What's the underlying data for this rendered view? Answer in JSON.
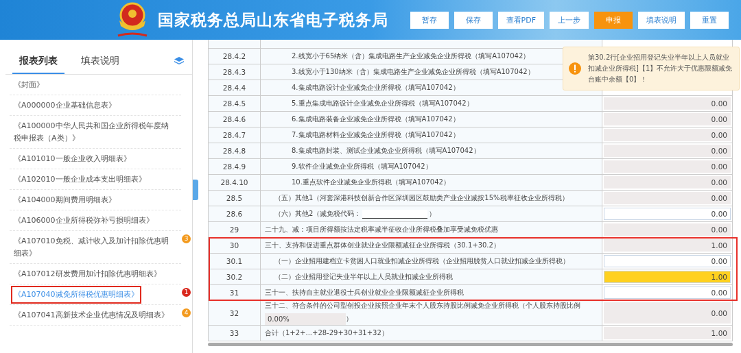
{
  "header": {
    "title": "国家税务总局山东省电子税务局",
    "buttons": [
      {
        "label": "暂存",
        "kind": "default"
      },
      {
        "label": "保存",
        "kind": "default"
      },
      {
        "label": "查看PDF",
        "kind": "default"
      },
      {
        "label": "上一步",
        "kind": "default"
      },
      {
        "label": "申报",
        "kind": "primary"
      },
      {
        "label": "填表说明",
        "kind": "default"
      },
      {
        "label": "重置",
        "kind": "default"
      }
    ]
  },
  "sidebar": {
    "tabs": [
      {
        "label": "报表列表",
        "selected": true
      },
      {
        "label": "填表说明",
        "selected": false
      }
    ],
    "items": [
      {
        "label": "《封面》",
        "selected": false
      },
      {
        "label": "《A000000企业基础信息表》",
        "selected": false
      },
      {
        "label": "《A100000中华人民共和国企业所得税年度纳税申报表（A类）》",
        "selected": false
      },
      {
        "label": "《A101010一般企业收入明细表》",
        "selected": false
      },
      {
        "label": "《A102010一般企业成本支出明细表》",
        "selected": false
      },
      {
        "label": "《A104000期间费用明细表》",
        "selected": false
      },
      {
        "label": "《A106000企业所得税弥补亏损明细表》",
        "selected": false
      },
      {
        "label": "《A107010免税、减计收入及加计扣除优惠明细表》",
        "selected": false,
        "badge": "3",
        "color": "#f39a1e"
      },
      {
        "label": "《A107012研发费用加计扣除优惠明细表》",
        "selected": false
      },
      {
        "label": "《A107040减免所得税优惠明细表》",
        "selected": true,
        "badge": "1",
        "color": "#d9281e"
      },
      {
        "label": "《A107041高新技术企业优惠情况及明细表》",
        "selected": false,
        "badge": "4",
        "color": "#f39a1e"
      }
    ]
  },
  "table": {
    "rows": [
      {
        "no": "28.4.2",
        "kind": "item",
        "text": "2.线宽小于65纳米（含）集成电路生产企业减免企业所得税（填写A107042）",
        "highlighted": false
      },
      {
        "no": "28.4.3",
        "kind": "item",
        "text": "3.线宽小于130纳米（含）集成电路生产企业减免企业所得税（填写A107042）",
        "highlighted": false
      },
      {
        "no": "28.4.4",
        "kind": "item",
        "text": "4.集成电路设计企业减免企业所得税（填写A107042）",
        "highlighted": false
      },
      {
        "no": "28.4.5",
        "kind": "item",
        "text": "5.重点集成电路设计企业减免企业所得税（填写A107042）",
        "value": "0.00",
        "editable": false,
        "warning": false,
        "highlighted": false
      },
      {
        "no": "28.4.6",
        "kind": "item",
        "text": "6.集成电路装备企业减免企业所得税（填写A107042）",
        "value": "0.00",
        "editable": false,
        "warning": false,
        "highlighted": false
      },
      {
        "no": "28.4.7",
        "kind": "item",
        "text": "7.集成电路材料企业减免企业所得税（填写A107042）",
        "value": "0.00",
        "editable": false,
        "warning": false,
        "highlighted": false
      },
      {
        "no": "28.4.8",
        "kind": "item",
        "text": "8.集成电路封装、测试企业减免企业所得税（填写A107042）",
        "value": "0.00",
        "editable": false,
        "warning": false,
        "highlighted": false
      },
      {
        "no": "28.4.9",
        "kind": "item",
        "text": "9.软件企业减免企业所得税（填写A107042）",
        "value": "0.00",
        "editable": false,
        "warning": false,
        "highlighted": false
      },
      {
        "no": "28.4.10",
        "kind": "item",
        "text": "10.重点软件企业减免企业所得税（填写A107042）",
        "value": "0.00",
        "editable": false,
        "warning": false,
        "highlighted": false
      },
      {
        "no": "28.5",
        "kind": "sub",
        "text": "（五）其他1（河套深港科技创新合作区深圳园区鼓励类产业企业减按15%税率征收企业所得税）",
        "value": "0.00",
        "editable": false,
        "warning": false,
        "highlighted": false
      },
      {
        "no": "28.6",
        "kind": "sub",
        "text": "（六）其他2（减免税代码：",
        "after": "）",
        "field": true,
        "value": "0.00",
        "editable": true,
        "warning": false,
        "highlighted": false
      },
      {
        "no": "29",
        "kind": "main",
        "text": "二十九、减：项目所得额按法定税率减半征收企业所得税叠加享受减免税优惠",
        "value": "0.00",
        "editable": false,
        "warning": false,
        "highlighted": false
      },
      {
        "no": "30",
        "kind": "main",
        "text": "三十、支持和促进重点群体创业就业企业限额减征企业所得税（30.1+30.2）",
        "value": "1.00",
        "editable": false,
        "warning": false,
        "highlighted": true
      },
      {
        "no": "30.1",
        "kind": "sub",
        "text": "（一）企业招用建档立卡贫困人口就业扣减企业所得税（企业招用脱贫人口就业扣减企业所得税）",
        "value": "0.00",
        "editable": true,
        "warning": false,
        "highlighted": true
      },
      {
        "no": "30.2",
        "kind": "sub",
        "text": "（二）企业招用登记失业半年以上人员就业扣减企业所得税",
        "value": "1.00",
        "editable": true,
        "warning": true,
        "highlighted": true
      },
      {
        "no": "31",
        "kind": "main",
        "text": "三十一、扶持自主就业退役士兵创业就业企业限额减征企业所得税",
        "value": "0.00",
        "editable": true,
        "warning": false,
        "highlighted": true
      },
      {
        "no": "32",
        "kind": "main",
        "text": "三十二、符合条件的公司型创投企业按照企业年末个人股东持股比例减免企业所得税（个人股东持股比例",
        "ratio": "0.00%",
        "after": "）",
        "value": "0.00",
        "editable": false,
        "warning": false,
        "highlighted": false
      },
      {
        "no": "33",
        "kind": "main",
        "text": "合计（1+2+...+28-29+30+31+32）",
        "value": "1.00",
        "editable": false,
        "warning": false,
        "highlighted": false
      }
    ]
  },
  "alert": {
    "message": "第30.2行[企业招用登记失业半年以上人员就业扣减企业所得税]【1】不允许大于优惠限额减免台账中余额【0】！"
  }
}
